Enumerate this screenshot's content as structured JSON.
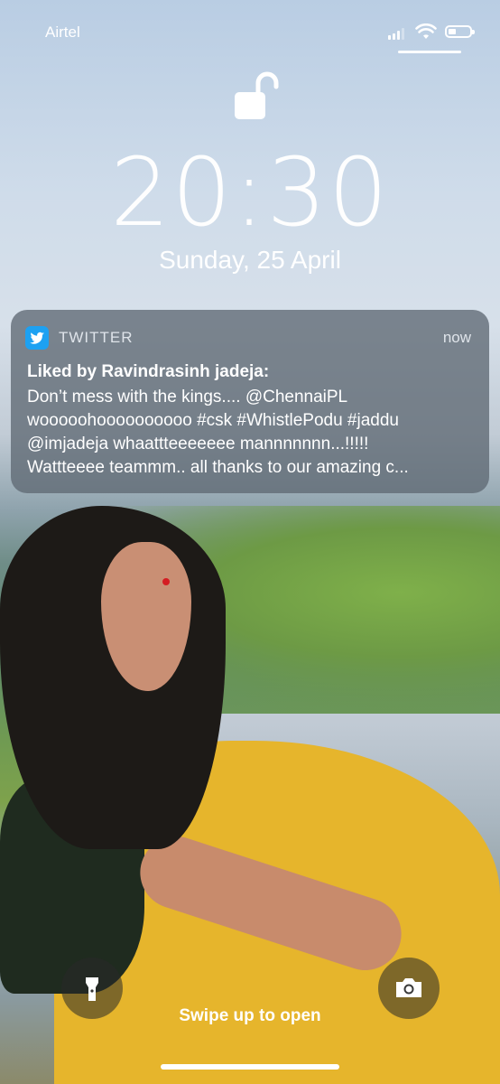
{
  "status_bar": {
    "carrier": "Airtel",
    "icons": [
      "signal-icon",
      "wifi-icon",
      "battery-icon"
    ]
  },
  "lock_screen": {
    "lock_state": "unlocked-padlock-icon",
    "time": "20:30",
    "date": "Sunday, 25 April"
  },
  "notification": {
    "app_icon": "twitter-bird-icon",
    "app_name": "TWITTER",
    "timestamp": "now",
    "title": "Liked by Ravindrasinh jadeja:",
    "lines": [
      "Don’t mess with the kings.... @ChennaiPL",
      "wooooohoooooooooo #csk #WhistlePodu #jaddu",
      "@imjadeja whaattteeeeeee mannnnnnn...!!!!!",
      "Wattteeee teammm.. all thanks to our amazing c..."
    ]
  },
  "bottom": {
    "flashlight_icon": "flashlight-icon",
    "camera_icon": "camera-icon",
    "swipe_text": "Swipe up to open"
  },
  "colors": {
    "accent_twitter": "#1da1f2",
    "notification_bg": "rgba(95,105,115,0.78)"
  }
}
